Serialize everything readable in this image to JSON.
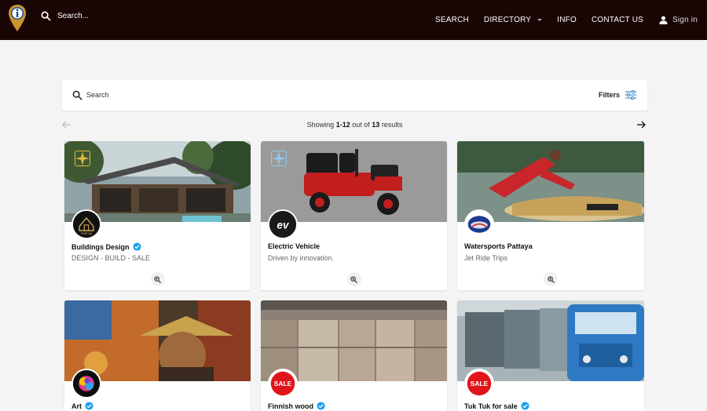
{
  "header": {
    "search_placeholder": "Search...",
    "nav": [
      {
        "label": "SEARCH"
      },
      {
        "label": "DIRECTORY"
      },
      {
        "label": "INFO"
      },
      {
        "label": "CONTACT US"
      }
    ],
    "signin_label": "Sign in"
  },
  "search": {
    "label": "Search",
    "filters_label": "Filters"
  },
  "pagination": {
    "prefix": "Showing",
    "range": "1-12",
    "middle": "out of",
    "total": "13",
    "suffix": "results"
  },
  "listings": [
    {
      "title": "Buildings Design",
      "subtitle": "DESIGN - BUILD - SALE",
      "featured": true,
      "avatar_text": "PREFAB"
    },
    {
      "title": "Electric Vehicle",
      "subtitle": "Driven by innovation.",
      "featured": true,
      "avatar_text": "ev"
    },
    {
      "title": "Watersports Pattaya",
      "subtitle": "Jet Ride Trips",
      "featured": false,
      "avatar_text": ""
    },
    {
      "title": "Art",
      "subtitle": "",
      "featured": false,
      "avatar_text": ""
    },
    {
      "title": "Finnish wood",
      "subtitle": "",
      "featured": false,
      "avatar_text": "SALE"
    },
    {
      "title": "Tuk Tuk for sale",
      "subtitle": "",
      "featured": false,
      "avatar_text": "SALE"
    }
  ],
  "colors": {
    "header_bg": "#1a0505",
    "page_bg": "#f4f4f4",
    "verified": "#1da1f2",
    "featured_gold": "#e3b93a",
    "featured_blue": "#8fc7ea",
    "filters_icon": "#3a8fc7"
  },
  "icons": {
    "logo": "map-pin-info-logo",
    "search": "search-icon",
    "user": "user-icon",
    "filters": "sliders-icon",
    "prev": "arrow-left-icon",
    "next": "arrow-right-icon",
    "verified": "verified-check-icon",
    "zoom": "zoom-in-icon",
    "featured": "sparkle-icon"
  }
}
